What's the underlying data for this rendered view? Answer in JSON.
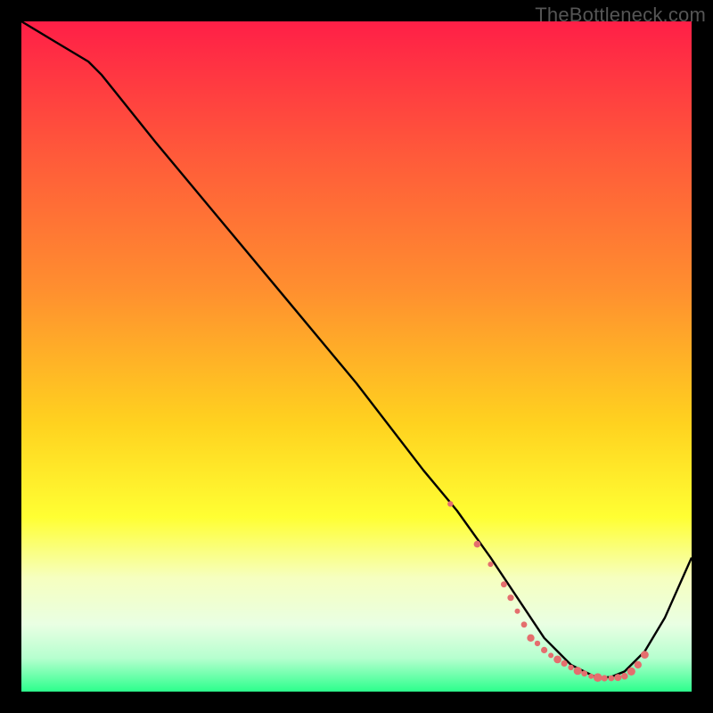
{
  "watermark": "TheBottleneck.com",
  "colors": {
    "curve": "#000000",
    "markers": "#e46e6e",
    "gradient_stops": [
      {
        "offset": 0.0,
        "color": "#ff1f47"
      },
      {
        "offset": 0.2,
        "color": "#ff5a3a"
      },
      {
        "offset": 0.4,
        "color": "#ff8f2f"
      },
      {
        "offset": 0.6,
        "color": "#ffd21f"
      },
      {
        "offset": 0.74,
        "color": "#ffff33"
      },
      {
        "offset": 0.83,
        "color": "#f6ffbf"
      },
      {
        "offset": 0.9,
        "color": "#e9ffe3"
      },
      {
        "offset": 0.95,
        "color": "#b6ffcf"
      },
      {
        "offset": 1.0,
        "color": "#2cff8c"
      }
    ]
  },
  "chart_data": {
    "type": "line",
    "title": "",
    "xlabel": "",
    "ylabel": "",
    "xlim": [
      0,
      100
    ],
    "ylim": [
      0,
      100
    ],
    "grid": false,
    "legend": false,
    "series": [
      {
        "name": "bottleneck-curve",
        "x": [
          0,
          5,
          10,
          12,
          20,
          30,
          40,
          50,
          60,
          65,
          70,
          74,
          78,
          80,
          82,
          84,
          86,
          88,
          90,
          93,
          96,
          100
        ],
        "values": [
          100,
          97,
          94,
          92,
          82,
          70,
          58,
          46,
          33,
          27,
          20,
          14,
          8,
          6,
          4,
          3,
          2,
          2.2,
          3,
          6,
          11,
          20
        ]
      }
    ],
    "markers": {
      "name": "fit-points",
      "x": [
        64,
        68,
        70,
        72,
        73,
        74,
        75,
        76,
        77,
        78,
        79,
        80,
        81,
        82,
        83,
        84,
        85,
        86,
        87,
        88,
        89,
        90,
        91,
        92,
        93
      ],
      "values": [
        28,
        22,
        19,
        16,
        14,
        12,
        10,
        8,
        7.2,
        6.2,
        5.4,
        4.8,
        4.2,
        3.6,
        3.1,
        2.7,
        2.3,
        2.1,
        2.0,
        2.0,
        2.1,
        2.3,
        3.0,
        4.0,
        5.5
      ],
      "radius": [
        3.2,
        3.8,
        3.0,
        3.4,
        3.6,
        3.0,
        3.4,
        4.2,
        3.2,
        3.6,
        3.0,
        4.4,
        3.6,
        3.2,
        4.6,
        3.4,
        3.0,
        4.8,
        3.6,
        3.4,
        4.0,
        3.8,
        4.6,
        4.2,
        4.4
      ]
    }
  }
}
